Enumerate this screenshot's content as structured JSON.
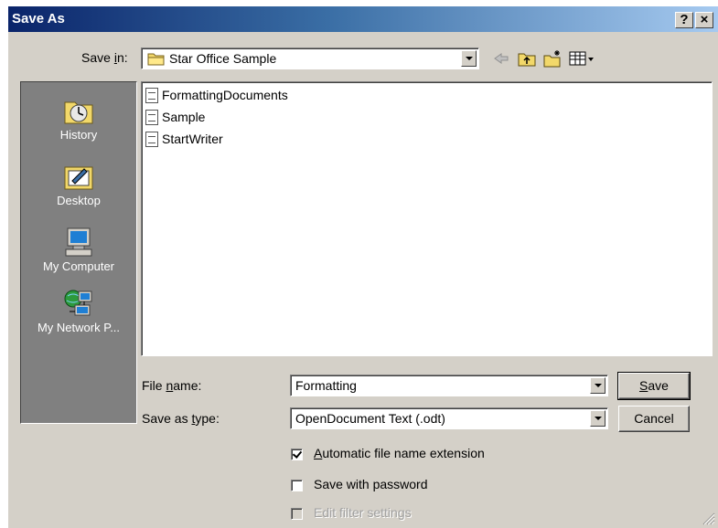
{
  "window": {
    "title": "Save As",
    "help_label": "?",
    "close_label": "×"
  },
  "save_in": {
    "label_pre": "Save ",
    "label_key": "i",
    "label_post": "n:",
    "value": "Star Office Sample"
  },
  "places": [
    {
      "label": "History",
      "icon": "history-icon"
    },
    {
      "label": "Desktop",
      "icon": "desktop-icon"
    },
    {
      "label": "My Computer",
      "icon": "my-computer-icon"
    },
    {
      "label": "My Network P...",
      "icon": "network-places-icon"
    }
  ],
  "files": [
    {
      "name": "FormattingDocuments"
    },
    {
      "name": "Sample"
    },
    {
      "name": "StartWriter"
    }
  ],
  "file_name": {
    "label_pre": "File ",
    "label_key": "n",
    "label_post": "ame:",
    "value": "Formatting"
  },
  "save_type": {
    "label_pre": "Save as ",
    "label_key": "t",
    "label_post": "ype:",
    "value": "OpenDocument Text (.odt)"
  },
  "buttons": {
    "save_key": "S",
    "save_rest": "ave",
    "cancel": "Cancel"
  },
  "options": {
    "auto_ext_key": "A",
    "auto_ext_rest": "utomatic file name extension",
    "auto_ext_checked": true,
    "password_label": "Save with password",
    "password_checked": false,
    "filter_label": "Edit filter settings",
    "filter_checked": false
  },
  "colors": {
    "title_start": "#0a246a",
    "title_end": "#a6caf0",
    "face": "#d4d0c8",
    "places_bg": "#808080"
  }
}
